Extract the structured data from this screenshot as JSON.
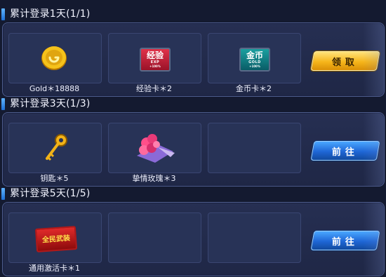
{
  "sections": [
    {
      "title": "累计登录1天(1/1)",
      "slots": [
        {
          "icon": "gold-coin-icon",
          "label": "Gold＊18888"
        },
        {
          "icon": "exp-card-icon",
          "label": "经验卡＊2",
          "badge_text": "经验",
          "badge_sub": "EXP",
          "badge_pct": "+100%"
        },
        {
          "icon": "gold-card-icon",
          "label": "金币卡＊2",
          "badge_text": "金币",
          "badge_sub": "GOLD",
          "badge_pct": "+100%"
        }
      ],
      "button": {
        "label": "领取",
        "style": "gold"
      }
    },
    {
      "title": "累计登录3天(1/3)",
      "slots": [
        {
          "icon": "key-icon",
          "label": "钥匙＊5"
        },
        {
          "icon": "rose-bouquet-icon",
          "label": "挚情玫瑰＊3"
        },
        {
          "icon": "",
          "label": ""
        }
      ],
      "button": {
        "label": "前往",
        "style": "blue"
      }
    },
    {
      "title": "累计登录5天(1/5)",
      "slots": [
        {
          "icon": "activation-card-icon",
          "label": "通用激活卡＊1",
          "badge_text": "全民武装"
        },
        {
          "icon": "",
          "label": ""
        },
        {
          "icon": "",
          "label": ""
        }
      ],
      "button": {
        "label": "前往",
        "style": "blue"
      }
    }
  ],
  "colors": {
    "background": "#141a30",
    "panel": "#262f52",
    "slot": "#283357",
    "gold_button": "#f6b51a",
    "blue_button": "#1e66d6"
  }
}
